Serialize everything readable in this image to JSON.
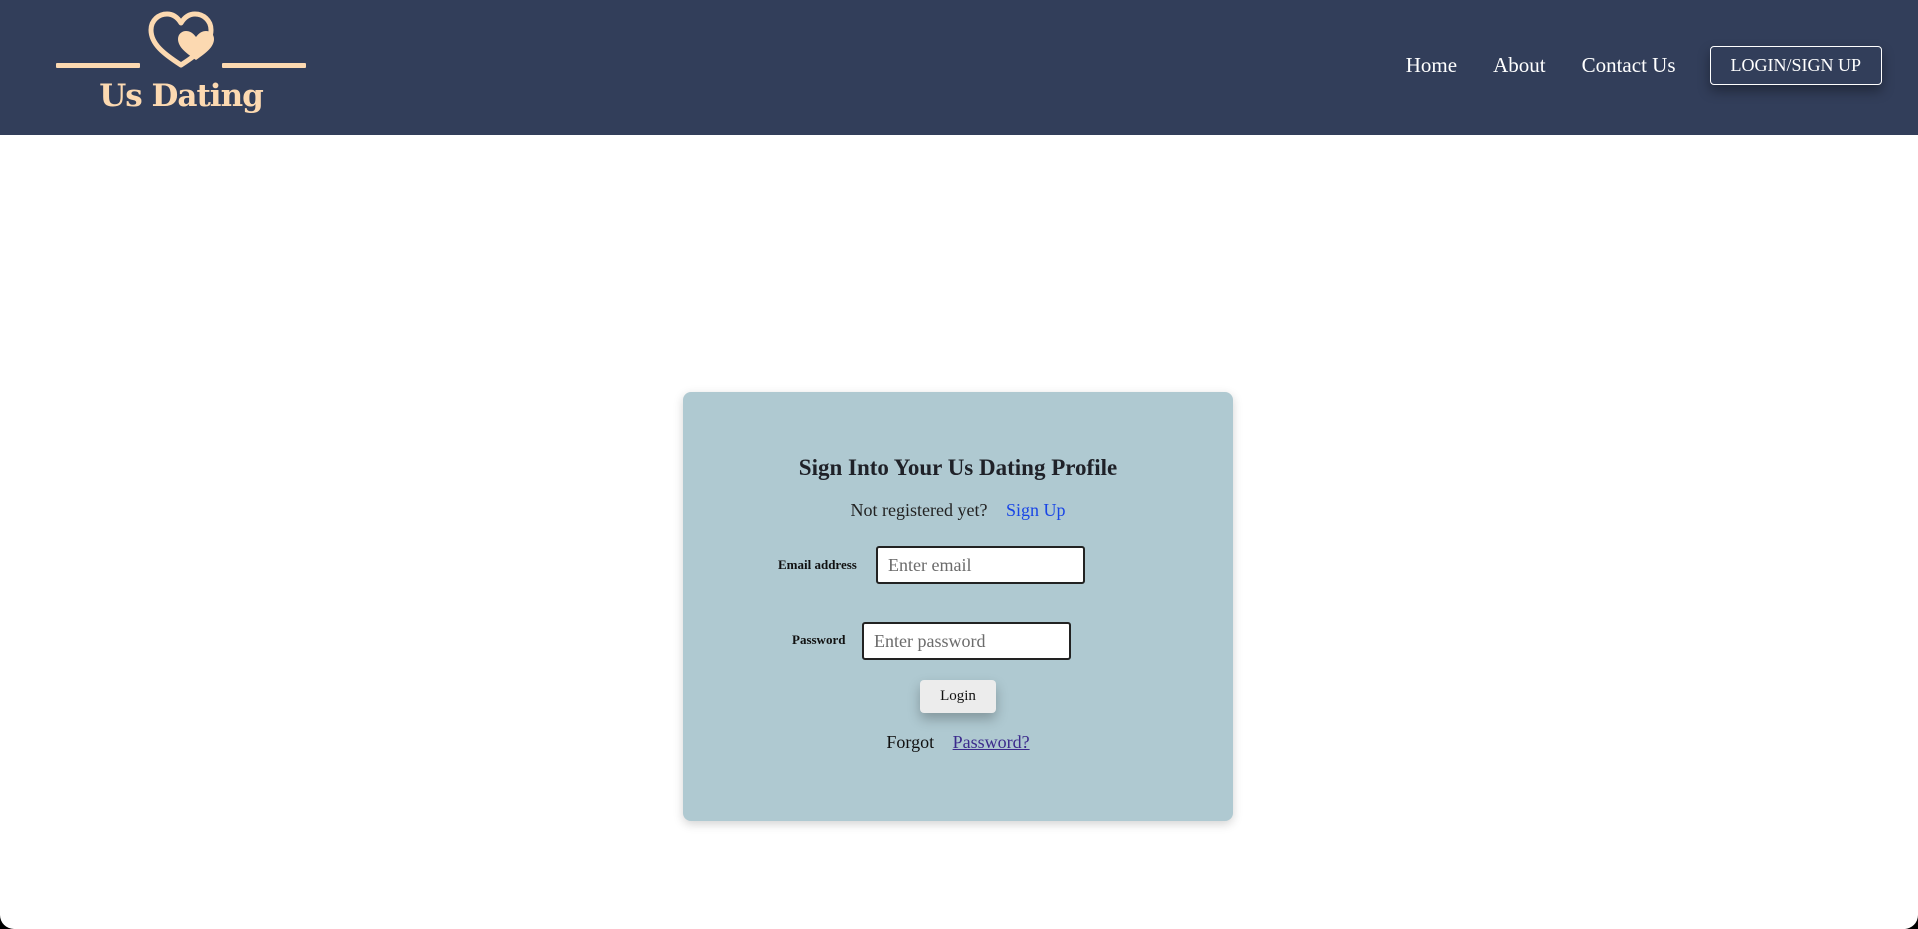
{
  "brand": {
    "name": "Us Dating",
    "color": "#fcd9b1",
    "logo_icon": "double-heart-icon"
  },
  "nav": {
    "background": "#323e5a",
    "links": [
      "Home",
      "About",
      "Contact Us"
    ],
    "cta_label": "LOGIN/SIGN UP"
  },
  "login_card": {
    "background": "#afc9d1",
    "title": "Sign Into Your Us Dating Profile",
    "not_registered": "Not registered yet?",
    "signup_link": "Sign Up",
    "email": {
      "label": "Email address",
      "placeholder": "Enter email",
      "value": ""
    },
    "password": {
      "label": "Password",
      "placeholder": "Enter password",
      "value": ""
    },
    "login_button": "Login",
    "forgot_text": "Forgot",
    "forgot_link": "Password?"
  }
}
